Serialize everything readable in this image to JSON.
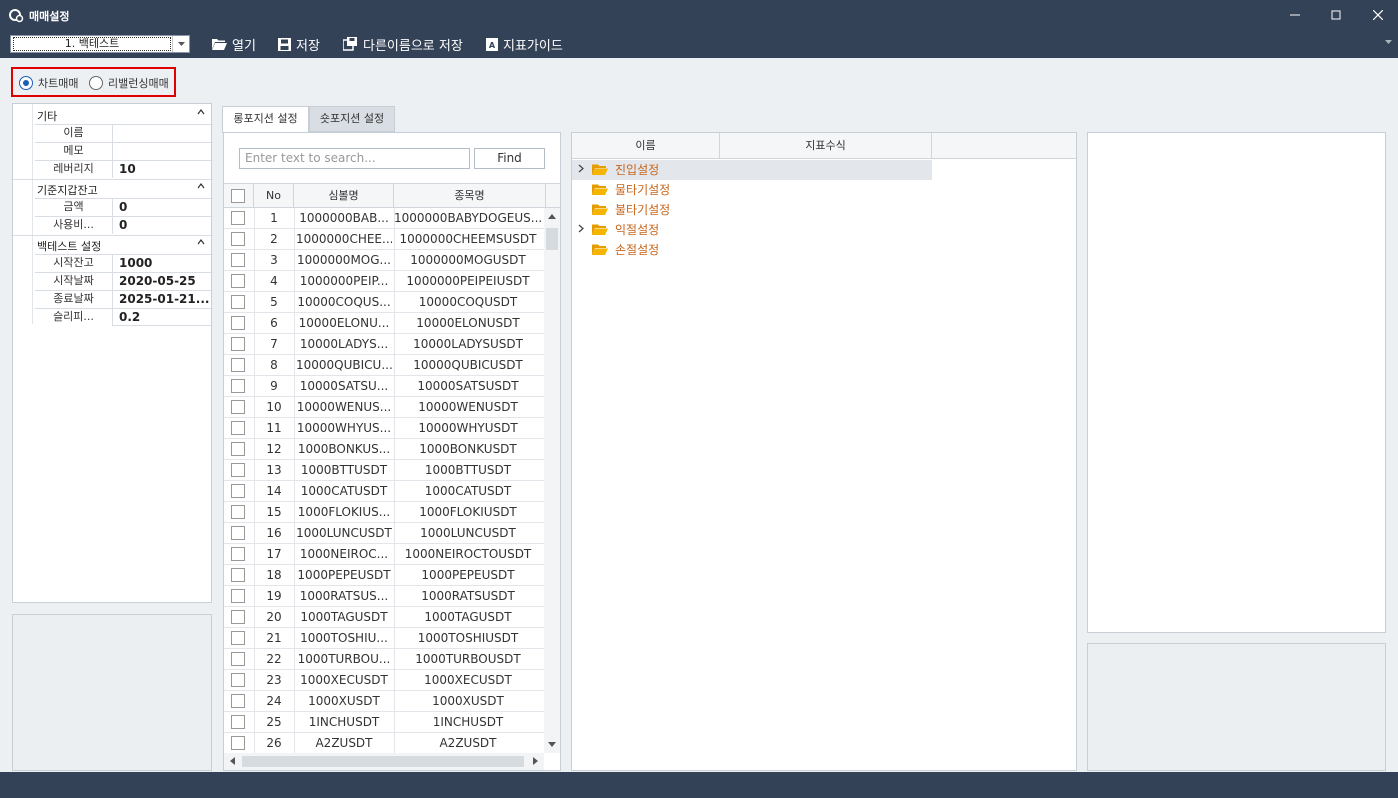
{
  "window": {
    "title": "매매설정",
    "icon": "gear-settings-icon"
  },
  "toolbar": {
    "preset": "1. 백테스트",
    "open": "열기",
    "save": "저장",
    "save_as": "다른이름으로 저장",
    "guide": "지표가이드"
  },
  "mode": {
    "chart": "차트매매",
    "rebalance": "리밸런싱매매",
    "selected": "chart"
  },
  "props": {
    "cat1": "기타",
    "name": "이름",
    "name_val": "",
    "memo": "메모",
    "memo_val": "",
    "leverage": "레버리지",
    "leverage_val": "10",
    "cat2": "기준지갑잔고",
    "amount": "금액",
    "amount_val": "0",
    "usage": "사용비...",
    "usage_val": "0",
    "cat3": "백테스트 설정",
    "start_balance": "시작잔고",
    "start_balance_val": "1000",
    "start_date": "시작날짜",
    "start_date_val": "2020-05-25",
    "end_date": "종료날짜",
    "end_date_val": "2025-01-21...",
    "slippage": "슬리피...",
    "slippage_val": "0.2"
  },
  "tabs": {
    "long": "롱포지션 설정",
    "short": "숏포지션 설정"
  },
  "symbols": {
    "placeholder": "Enter text to search...",
    "find": "Find",
    "col_no": "No",
    "col_symbol": "심볼명",
    "col_name": "종목명",
    "rows": [
      {
        "no": "1",
        "sym": "1000000BAB...",
        "name": "1000000BABYDOGEUS..."
      },
      {
        "no": "2",
        "sym": "1000000CHEE...",
        "name": "1000000CHEEMSUSDT"
      },
      {
        "no": "3",
        "sym": "1000000MOG...",
        "name": "1000000MOGUSDT"
      },
      {
        "no": "4",
        "sym": "1000000PEIP...",
        "name": "1000000PEIPEIUSDT"
      },
      {
        "no": "5",
        "sym": "10000COQUS...",
        "name": "10000COQUSDT"
      },
      {
        "no": "6",
        "sym": "10000ELONU...",
        "name": "10000ELONUSDT"
      },
      {
        "no": "7",
        "sym": "10000LADYS...",
        "name": "10000LADYSUSDT"
      },
      {
        "no": "8",
        "sym": "10000QUBICU...",
        "name": "10000QUBICUSDT"
      },
      {
        "no": "9",
        "sym": "10000SATSU...",
        "name": "10000SATSUSDT"
      },
      {
        "no": "10",
        "sym": "10000WENUS...",
        "name": "10000WENUSDT"
      },
      {
        "no": "11",
        "sym": "10000WHYUS...",
        "name": "10000WHYUSDT"
      },
      {
        "no": "12",
        "sym": "1000BONKUS...",
        "name": "1000BONKUSDT"
      },
      {
        "no": "13",
        "sym": "1000BTTUSDT",
        "name": "1000BTTUSDT"
      },
      {
        "no": "14",
        "sym": "1000CATUSDT",
        "name": "1000CATUSDT"
      },
      {
        "no": "15",
        "sym": "1000FLOKIUS...",
        "name": "1000FLOKIUSDT"
      },
      {
        "no": "16",
        "sym": "1000LUNCUSDT",
        "name": "1000LUNCUSDT"
      },
      {
        "no": "17",
        "sym": "1000NEIROC...",
        "name": "1000NEIROCTOUSDT"
      },
      {
        "no": "18",
        "sym": "1000PEPEUSDT",
        "name": "1000PEPEUSDT"
      },
      {
        "no": "19",
        "sym": "1000RATSUS...",
        "name": "1000RATSUSDT"
      },
      {
        "no": "20",
        "sym": "1000TAGUSDT",
        "name": "1000TAGUSDT"
      },
      {
        "no": "21",
        "sym": "1000TOSHIU...",
        "name": "1000TOSHIUSDT"
      },
      {
        "no": "22",
        "sym": "1000TURBOU...",
        "name": "1000TURBOUSDT"
      },
      {
        "no": "23",
        "sym": "1000XECUSDT",
        "name": "1000XECUSDT"
      },
      {
        "no": "24",
        "sym": "1000XUSDT",
        "name": "1000XUSDT"
      },
      {
        "no": "25",
        "sym": "1INCHUSDT",
        "name": "1INCHUSDT"
      },
      {
        "no": "26",
        "sym": "A2ZUSDT",
        "name": "A2ZUSDT"
      }
    ]
  },
  "tree": {
    "col_name": "이름",
    "col_formula": "지표수식",
    "nodes": [
      {
        "label": "진입설정",
        "expandable": true
      },
      {
        "label": "물타기설정",
        "expandable": false
      },
      {
        "label": "불타기설정",
        "expandable": false
      },
      {
        "label": "익절설정",
        "expandable": true
      },
      {
        "label": "손절설정",
        "expandable": false
      }
    ]
  },
  "colors": {
    "titlebar": "#344257",
    "highlight": "#e00000",
    "tree_label": "#c8651b",
    "folder": "#f4b400"
  }
}
